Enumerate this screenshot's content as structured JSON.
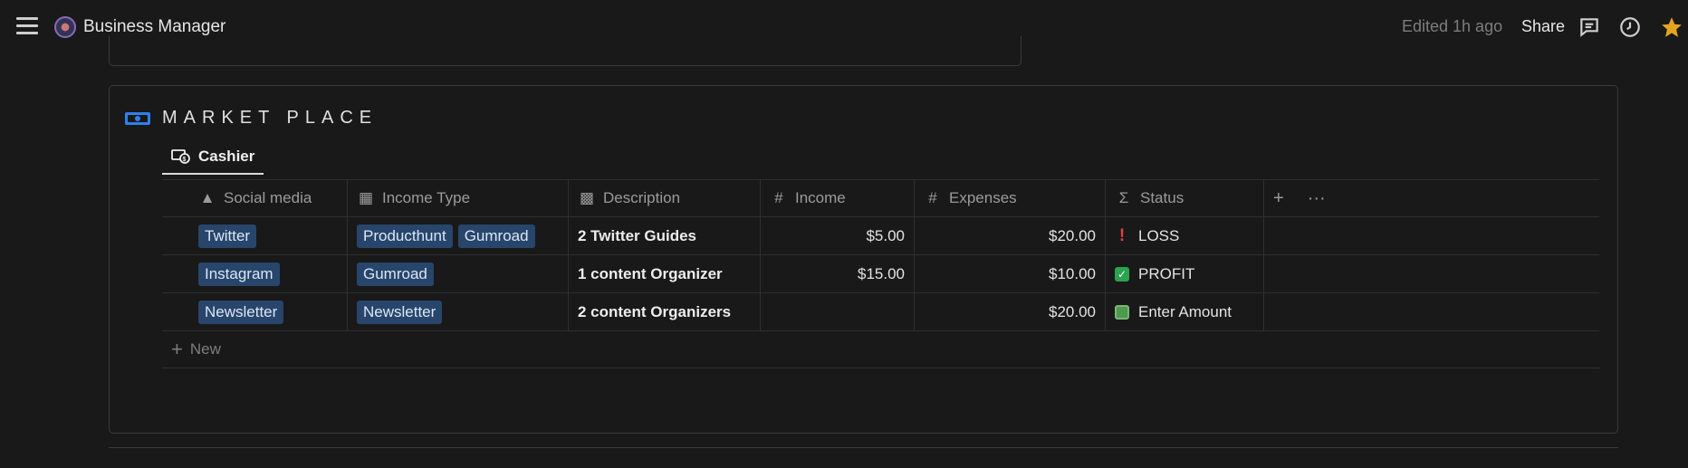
{
  "topbar": {
    "title": "Business Manager",
    "edited": "Edited 1h ago",
    "share": "Share"
  },
  "block": {
    "title": "MARKET PLACE",
    "tab_label": "Cashier"
  },
  "table": {
    "columns": {
      "social": "Social media",
      "income_type": "Income Type",
      "description": "Description",
      "income": "Income",
      "expenses": "Expenses",
      "status": "Status"
    },
    "add_col": "+",
    "more": "···",
    "rows": [
      {
        "social": "Twitter",
        "types": [
          "Producthunt",
          "Gumroad"
        ],
        "description": "2 Twitter Guides",
        "income": "$5.00",
        "expenses": "$20.00",
        "status": "LOSS",
        "status_icon": "exclamation-icon"
      },
      {
        "social": "Instagram",
        "types": [
          "Gumroad"
        ],
        "description": "1 content Organizer",
        "income": "$15.00",
        "expenses": "$10.00",
        "status": "PROFIT",
        "status_icon": "check-icon"
      },
      {
        "social": "Newsletter",
        "types": [
          "Newsletter"
        ],
        "description": "2 content Organizers",
        "income": "",
        "expenses": "$20.00",
        "status": "Enter Amount",
        "status_icon": "money-icon"
      }
    ],
    "new_label": "New"
  },
  "colors": {
    "background": "#191919",
    "tag_bg": "#28456c",
    "accent_blue": "#2f80ed",
    "star": "#e5a41f"
  }
}
